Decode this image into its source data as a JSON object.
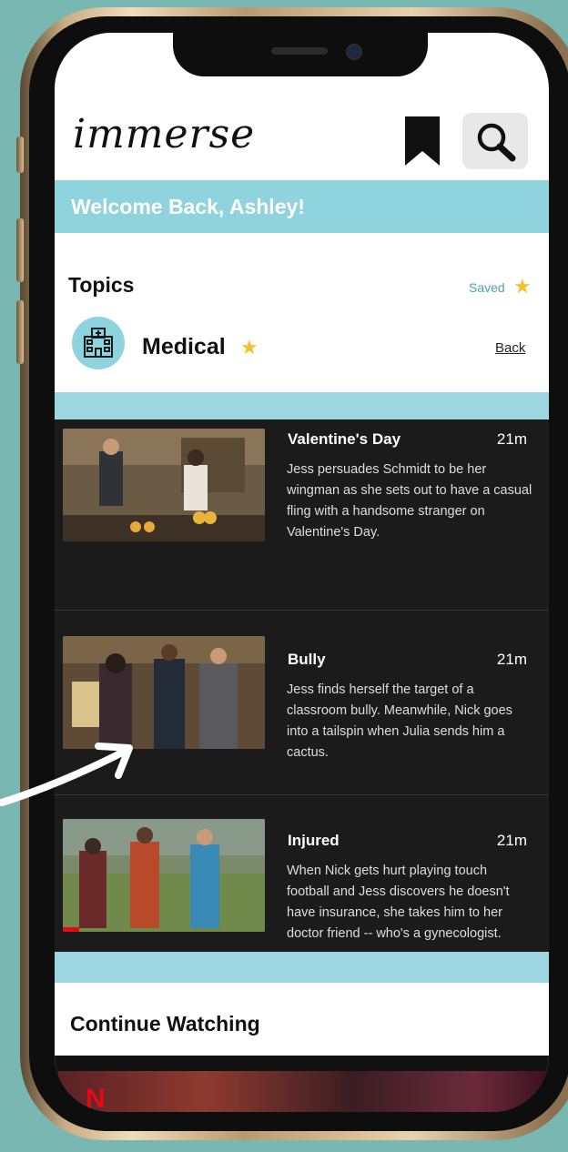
{
  "app": {
    "logo": "immerse"
  },
  "header": {
    "bookmark_icon": "bookmark-icon",
    "search_icon": "search-icon"
  },
  "welcome": "Welcome Back, Ashley!",
  "topics": {
    "label": "Topics",
    "saved_label": "Saved",
    "current": {
      "name": "Medical",
      "icon": "hospital-icon",
      "starred": true
    },
    "back_label": "Back"
  },
  "episodes": [
    {
      "title": "Valentine's Day",
      "duration": "21m",
      "description": "Jess persuades Schmidt to be her wingman as she sets out to have a casual fling with a handsome stranger on Valentine's Day."
    },
    {
      "title": "Bully",
      "duration": "21m",
      "description": "Jess finds herself the target of a classroom bully. Meanwhile, Nick goes into a tailspin when Julia sends him a cactus."
    },
    {
      "title": "Injured",
      "duration": "21m",
      "description": "When Nick gets hurt playing touch football and Jess discovers he doesn't have insurance, she takes him to her doctor friend -- who's a gynecologist."
    }
  ],
  "continue_watching": {
    "label": "Continue Watching",
    "brand_letter": "N"
  },
  "colors": {
    "accent": "#8ed3de",
    "band": "#9dd8e2",
    "star": "#f2c12e",
    "list_bg": "#1b1b1b",
    "background": "#79b8b2"
  }
}
